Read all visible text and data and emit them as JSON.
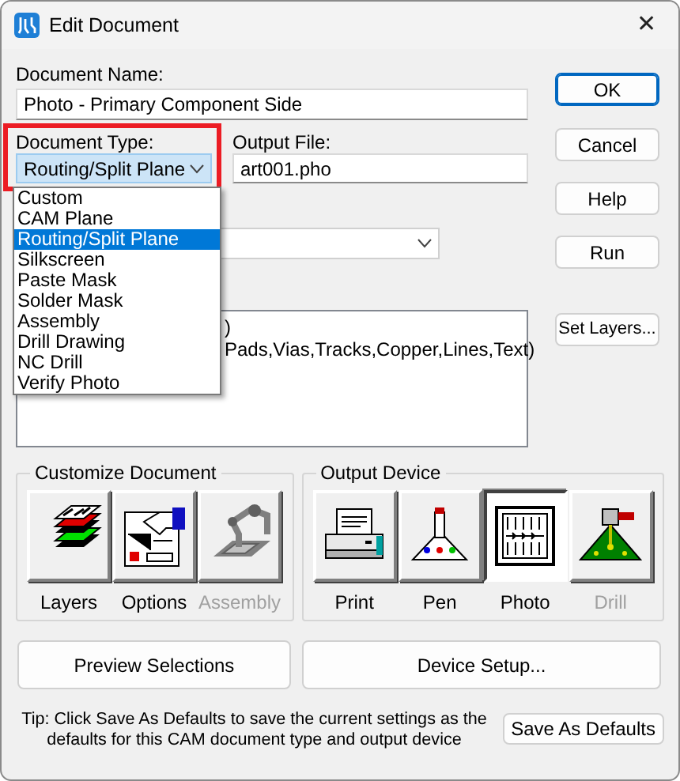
{
  "window": {
    "title": "Edit Document",
    "close": "✕"
  },
  "document_name": {
    "label": "Document Name:",
    "value": "Photo - Primary Component Side"
  },
  "document_type": {
    "label": "Document Type:",
    "value": "Routing/Split Plane",
    "highlighted": true,
    "expanded": true,
    "options": [
      {
        "label": "Custom",
        "selected": false
      },
      {
        "label": "CAM Plane",
        "selected": false
      },
      {
        "label": "Routing/Split Plane",
        "selected": true
      },
      {
        "label": "Silkscreen",
        "selected": false
      },
      {
        "label": "Paste Mask",
        "selected": false
      },
      {
        "label": "Solder Mask",
        "selected": false
      },
      {
        "label": "Assembly",
        "selected": false
      },
      {
        "label": "Drill Drawing",
        "selected": false
      },
      {
        "label": "NC Drill",
        "selected": false
      },
      {
        "label": "Verify Photo",
        "selected": false
      }
    ]
  },
  "output_file": {
    "label": "Output File:",
    "value": "art001.pho"
  },
  "layers_text": [
    ")",
    "Pads,Vias,Tracks,Copper,Lines,Text)"
  ],
  "dialog_buttons": [
    "OK",
    "Cancel",
    "Help",
    "Run"
  ],
  "set_layers_button": "Set Layers...",
  "customize": {
    "title": "Customize Document",
    "buttons": [
      {
        "label": "Layers",
        "kind": "layers",
        "disabled": false
      },
      {
        "label": "Options",
        "kind": "options",
        "disabled": false
      },
      {
        "label": "Assembly",
        "kind": "assembly",
        "disabled": true
      }
    ]
  },
  "output_device": {
    "title": "Output Device",
    "devices": [
      {
        "label": "Print",
        "kind": "print",
        "selected": false,
        "disabled": false
      },
      {
        "label": "Pen",
        "kind": "pen",
        "selected": false,
        "disabled": false
      },
      {
        "label": "Photo",
        "kind": "photo",
        "selected": true,
        "disabled": false
      },
      {
        "label": "Drill",
        "kind": "drill",
        "selected": false,
        "disabled": true
      }
    ]
  },
  "preview_button": "Preview Selections",
  "device_setup_button": "Device Setup...",
  "tip": "Tip: Click Save As Defaults to save the current settings as the defaults for this CAM document type and output device",
  "save_defaults_button": "Save As Defaults"
}
